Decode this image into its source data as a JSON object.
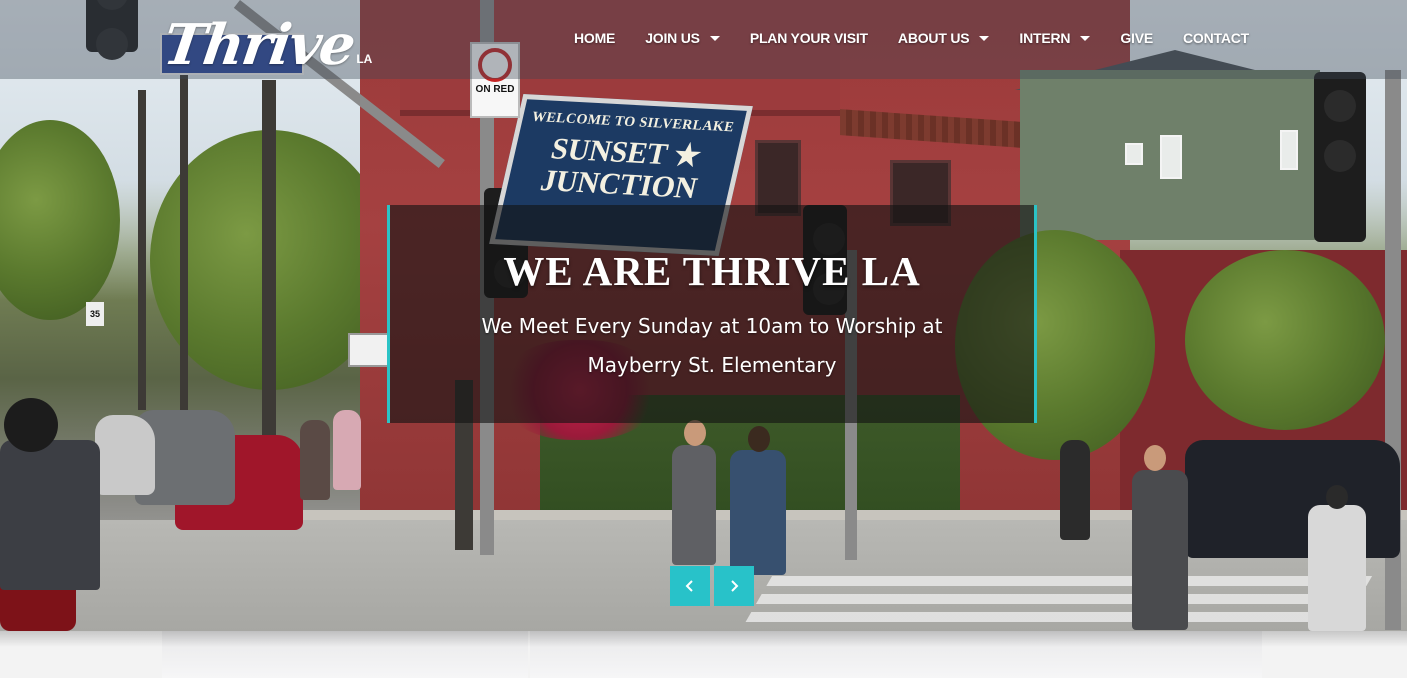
{
  "brand": {
    "logo_text": "Thrive",
    "logo_suffix": "LA"
  },
  "nav": {
    "items": [
      {
        "label": "HOME",
        "has_dropdown": false
      },
      {
        "label": "JOIN US",
        "has_dropdown": true
      },
      {
        "label": "PLAN YOUR VISIT",
        "has_dropdown": false
      },
      {
        "label": "ABOUT US",
        "has_dropdown": true
      },
      {
        "label": "INTERN",
        "has_dropdown": true
      },
      {
        "label": "GIVE",
        "has_dropdown": false
      },
      {
        "label": "CONTACT",
        "has_dropdown": false
      }
    ]
  },
  "hero": {
    "title": "WE ARE THRIVE LA",
    "subtitle": "We Meet Every Sunday at 10am to Worship at Mayberry St. Elementary",
    "photo_signs": {
      "sunset_line1": "WELCOME TO SILVERLAKE",
      "sunset_line2": "SUNSET ★ JUNCTION",
      "no_turn": "ON RED",
      "speed": "35"
    }
  },
  "slider": {
    "prev_icon": "chevron-left-icon",
    "next_icon": "chevron-right-icon"
  },
  "colors": {
    "accent": "#28c2c9",
    "nav_text": "#ffffff",
    "caption_bg": "rgba(20,20,20,0.62)"
  }
}
